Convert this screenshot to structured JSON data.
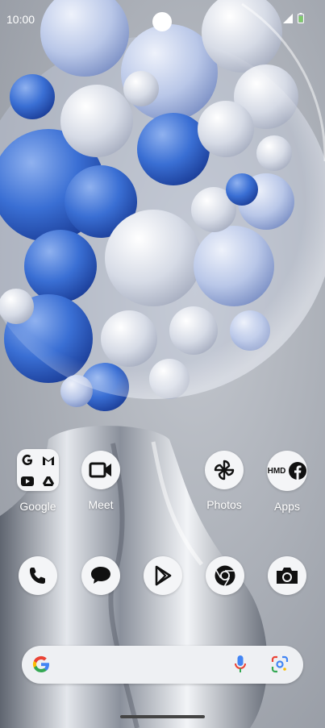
{
  "status_bar": {
    "time": "10:00",
    "icons": [
      "signal-icon",
      "battery-icon"
    ]
  },
  "wallpaper": {
    "description_colors": {
      "blue": "#2f63c5",
      "light": "#dfe5f0",
      "bg": "#a9adb5"
    }
  },
  "apps_row1": [
    {
      "label": "Google",
      "icon": "google-folder-icon"
    },
    {
      "label": "Meet",
      "icon": "meet-icon"
    },
    {
      "label": "Photos",
      "icon": "photos-pinwheel-icon"
    },
    {
      "label": "Apps",
      "icon": "apps-folder-icon"
    }
  ],
  "folder_apps_text": {
    "hmd": "HMD"
  },
  "dock": [
    {
      "icon": "phone-icon"
    },
    {
      "icon": "messages-icon"
    },
    {
      "icon": "play-store-icon"
    },
    {
      "icon": "chrome-icon"
    },
    {
      "icon": "camera-icon"
    }
  ],
  "search": {
    "icons": [
      "google-g-icon",
      "microphone-icon",
      "google-lens-icon"
    ]
  }
}
